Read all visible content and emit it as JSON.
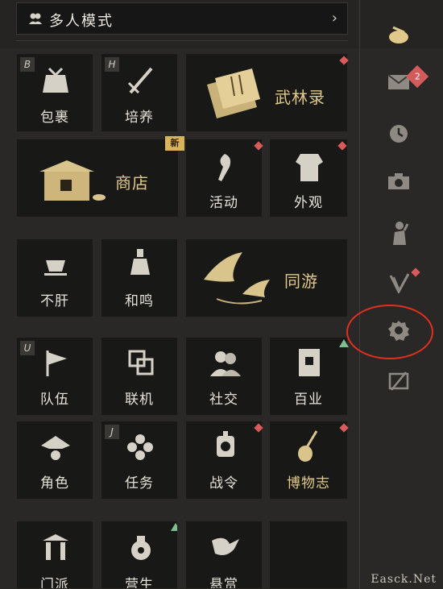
{
  "header": {
    "title": "多人模式",
    "chevron": "›",
    "icon": "people-icon"
  },
  "tiles": {
    "bag": {
      "label": "包裹",
      "key": "B"
    },
    "train": {
      "label": "培养",
      "key": "H"
    },
    "wulin": {
      "label": "武林录"
    },
    "shop": {
      "label": "商店",
      "badge": "新"
    },
    "event": {
      "label": "活动"
    },
    "appearance": {
      "label": "外观"
    },
    "buqian": {
      "label": "不肝"
    },
    "heming": {
      "label": "和鸣"
    },
    "tongyou": {
      "label": "同游"
    },
    "team": {
      "label": "队伍",
      "key": "U"
    },
    "online": {
      "label": "联机"
    },
    "social": {
      "label": "社交"
    },
    "baiye": {
      "label": "百业"
    },
    "role": {
      "label": "角色"
    },
    "quest": {
      "label": "任务",
      "key": "J"
    },
    "battlepass": {
      "label": "战令"
    },
    "bowuzhi": {
      "label": "博物志"
    },
    "partial1": {
      "label": "门派"
    },
    "partial2": {
      "label": "营生"
    },
    "partial3": {
      "label": "悬赏"
    }
  },
  "sidebar": {
    "mail_badge": "2",
    "icons": [
      "tea-icon",
      "mail-icon",
      "clock-icon",
      "camera-icon",
      "gesture-icon",
      "pen-icon",
      "settings-icon",
      "screen-off-icon"
    ]
  },
  "colors": {
    "accent": "#e0c98a",
    "dot": "#d85a5a",
    "highlight": "#e03020"
  },
  "watermark": "Easck.Net"
}
